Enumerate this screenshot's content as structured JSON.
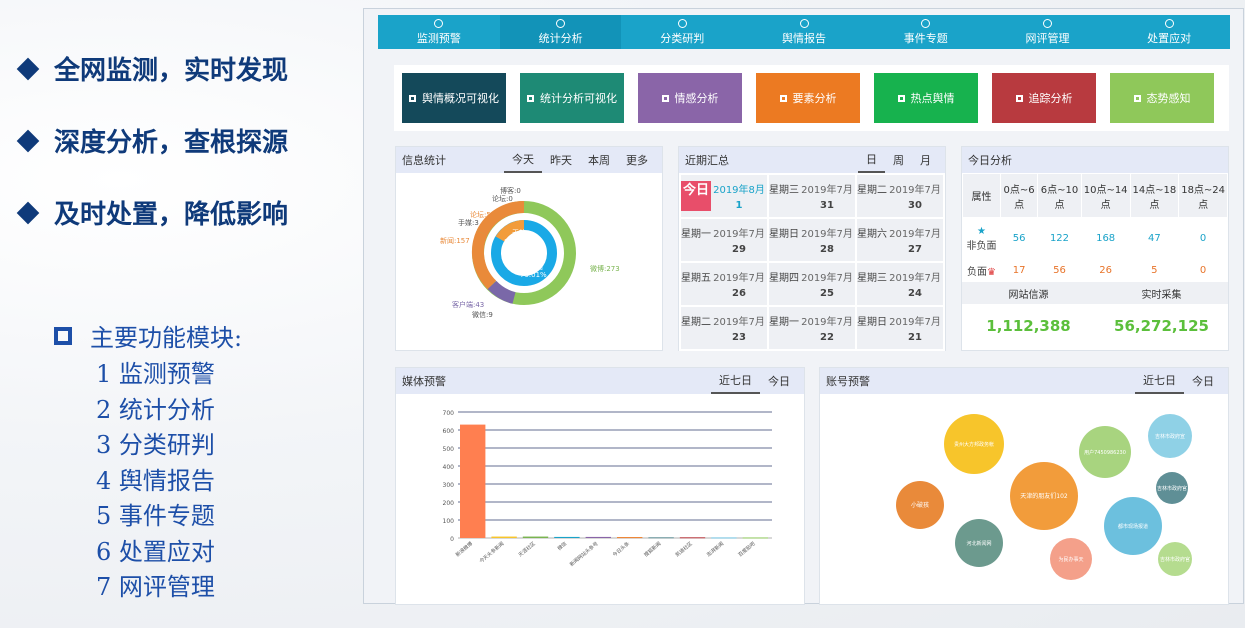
{
  "left": {
    "bullets": [
      "全网监测，实时发现",
      "深度分析，查根探源",
      "及时处置，降低影响"
    ],
    "modules_title": "主要功能模块:",
    "modules": [
      "1 监测预警",
      "2 统计分析",
      "3 分类研判",
      "4 舆情报告",
      "5 事件专题",
      "6 处置应对",
      "7 网评管理"
    ]
  },
  "nav": [
    "监测预警",
    "统计分析",
    "分类研判",
    "舆情报告",
    "事件专题",
    "网评管理",
    "处置应对"
  ],
  "tiles": [
    {
      "label": "舆情概况可视化",
      "color": "#14495a"
    },
    {
      "label": "统计分析可视化",
      "color": "#1e8a75"
    },
    {
      "label": "情感分析",
      "color": "#8a65a8"
    },
    {
      "label": "要素分析",
      "color": "#ec7a22"
    },
    {
      "label": "热点舆情",
      "color": "#17b24e"
    },
    {
      "label": "追踪分析",
      "color": "#b83a3f"
    },
    {
      "label": "态势感知",
      "color": "#8fc85a"
    }
  ],
  "info_stats": {
    "title": "信息统计",
    "tabs": [
      "今天",
      "昨天",
      "本周",
      "更多"
    ],
    "center_labels": [
      "无效",
      "80.93%",
      "非负面",
      "79.01%"
    ],
    "slice_labels": [
      "博客:0",
      "论坛:0",
      "论坛:5",
      "手媒:3",
      "新闻:157",
      "微博:273",
      "客户端:43",
      "微信:9"
    ]
  },
  "recent": {
    "title": "近期汇总",
    "tabs": [
      "日",
      "周",
      "月"
    ],
    "today_label": "今日",
    "rows": [
      [
        {
          "w": "今日",
          "d": "2019年8月",
          "n": "1"
        },
        {
          "w": "星期三",
          "d": "2019年7月",
          "n": "31"
        },
        {
          "w": "星期二",
          "d": "2019年7月",
          "n": "30"
        }
      ],
      [
        {
          "w": "星期一",
          "d": "2019年7月",
          "n": "29"
        },
        {
          "w": "星期日",
          "d": "2019年7月",
          "n": "28"
        },
        {
          "w": "星期六",
          "d": "2019年7月",
          "n": "27"
        }
      ],
      [
        {
          "w": "星期五",
          "d": "2019年7月",
          "n": "26"
        },
        {
          "w": "星期四",
          "d": "2019年7月",
          "n": "25"
        },
        {
          "w": "星期三",
          "d": "2019年7月",
          "n": "24"
        }
      ],
      [
        {
          "w": "星期二",
          "d": "2019年7月",
          "n": "23"
        },
        {
          "w": "星期一",
          "d": "2019年7月",
          "n": "22"
        },
        {
          "w": "星期日",
          "d": "2019年7月",
          "n": "21"
        }
      ]
    ]
  },
  "today_analysis": {
    "title": "今日分析",
    "headers": [
      "属性",
      "0点~6点",
      "6点~10点",
      "10点~14点",
      "14点~18点",
      "18点~24点"
    ],
    "row1_label": "非负面",
    "row1": [
      "56",
      "122",
      "168",
      "47",
      "0"
    ],
    "row2_label": "负面",
    "row2": [
      "17",
      "56",
      "26",
      "5",
      "0"
    ],
    "footer_labels": [
      "网站信源",
      "实时采集"
    ],
    "footer_values": [
      "1,112,388",
      "56,272,125"
    ]
  },
  "media_alert": {
    "title": "媒体预警",
    "tabs": [
      "近七日",
      "今日"
    ]
  },
  "account_alert": {
    "title": "账号预警",
    "tabs": [
      "近七日",
      "今日"
    ],
    "bubbles": [
      {
        "label": "贵州大方邦政务帐",
        "color": "#f7c52b"
      },
      {
        "label": "用户7450986230",
        "color": "#a8d47f"
      },
      {
        "label": "吉林市政府宣",
        "color": "#8fd1e6"
      },
      {
        "label": "小破孩",
        "color": "#e98a3a"
      },
      {
        "label": "天津的朋友们102",
        "color": "#f29c3b"
      },
      {
        "label": "吉林市政府官",
        "color": "#5f8f96"
      },
      {
        "label": "河北新闻网",
        "color": "#6c9a8e"
      },
      {
        "label": "都市现场报道",
        "color": "#6cc0de"
      },
      {
        "label": "为民办事天",
        "color": "#f4a08a"
      },
      {
        "label": "吉林市政府官",
        "color": "#b5dc8f"
      }
    ]
  },
  "chart_data": {
    "type": "bar",
    "categories": [
      "新浪微博",
      "今天头条新闻",
      "天涯社区",
      "微信",
      "新闻网站头条号",
      "今日头条",
      "搜狐新闻",
      "凯迪社区",
      "澎湃新闻",
      "百度贴吧"
    ],
    "values": [
      630,
      8,
      8,
      6,
      6,
      5,
      4,
      4,
      3,
      3
    ],
    "yticks": [
      "0",
      "100",
      "200",
      "300",
      "400",
      "500",
      "600",
      "700"
    ],
    "ylim": [
      0,
      700
    ]
  }
}
